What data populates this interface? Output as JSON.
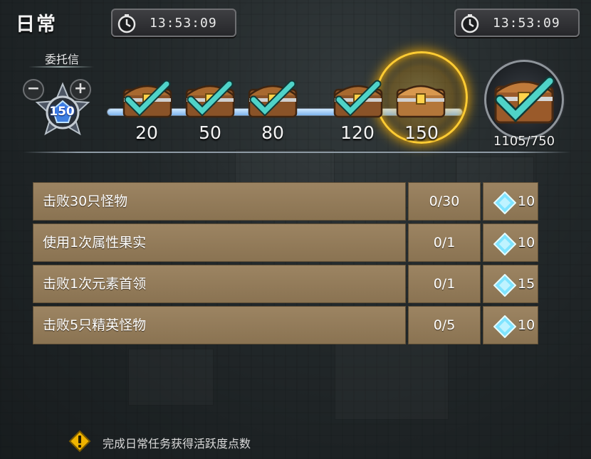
{
  "header": {
    "title": "日常",
    "timer_left": "13:53:09",
    "timer_right": "13:53:09"
  },
  "activity": {
    "label": "委托信",
    "points": "150",
    "icons": {
      "minus": "minus-icon",
      "plus": "plus-icon",
      "emblem": "activity-emblem-icon"
    }
  },
  "progress": {
    "current": 150,
    "max": 150,
    "tiers": [
      {
        "value": "20",
        "state": "claimed"
      },
      {
        "value": "50",
        "state": "claimed"
      },
      {
        "value": "80",
        "state": "claimed"
      },
      {
        "value": "120",
        "state": "claimed"
      },
      {
        "value": "150",
        "state": "claimable"
      }
    ]
  },
  "weekly": {
    "count": "1105/750",
    "state": "claimed"
  },
  "tasks": [
    {
      "name": "击败30只怪物",
      "progress": "0/30",
      "reward": "10"
    },
    {
      "name": "使用1次属性果实",
      "progress": "0/1",
      "reward": "10"
    },
    {
      "name": "击败1次元素首领",
      "progress": "0/1",
      "reward": "15"
    },
    {
      "name": "击败5只精英怪物",
      "progress": "0/5",
      "reward": "10"
    }
  ],
  "footer": {
    "tip": "完成日常任务获得活跃度点数",
    "icon": "warning-icon"
  },
  "colors": {
    "row_bg": "#9c8462",
    "check": "#4fd3c8",
    "glow": "#ffcc33",
    "gem": "#7fe4ff"
  }
}
